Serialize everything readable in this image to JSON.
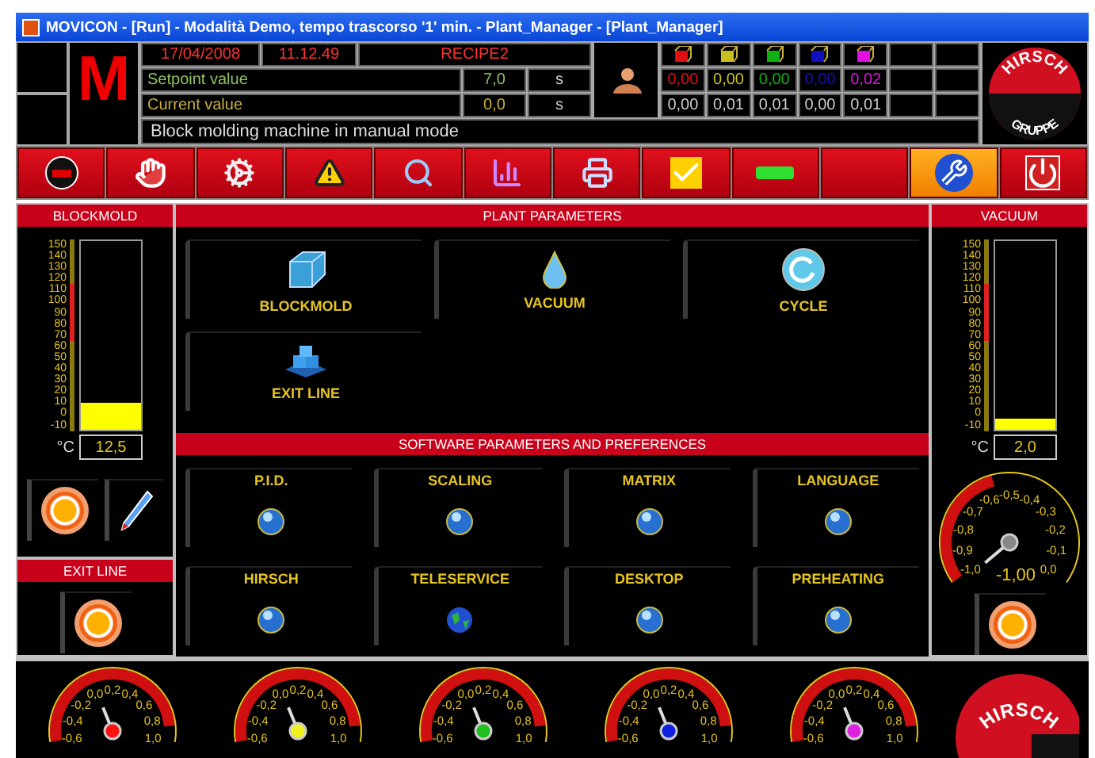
{
  "window": {
    "title": "MOVICON - [Run] - Modalità Demo, tempo trascorso '1' min. - Plant_Manager - [Plant_Manager]"
  },
  "header": {
    "logo_letter": "M",
    "date": "17/04/2008",
    "time": "11.12.49",
    "recipe": "RECIPE2",
    "setpoint": {
      "label": "Setpoint value",
      "value": "7,0",
      "unit": "s"
    },
    "current": {
      "label": "Current value",
      "value": "0,0",
      "unit": "s"
    },
    "channels": [
      {
        "color": "#e01010",
        "setpoint": "0,00",
        "current": "0,00"
      },
      {
        "color": "#c8c020",
        "setpoint": "0,00",
        "current": "0,01"
      },
      {
        "color": "#10b010",
        "setpoint": "0,00",
        "current": "0,01"
      },
      {
        "color": "#1010c0",
        "setpoint": "0,00",
        "current": "0,00"
      },
      {
        "color": "#e010e0",
        "setpoint": "0,02",
        "current": "0,01"
      }
    ],
    "message": "Block molding machine in manual mode",
    "brand": {
      "top": "HIRSCH",
      "bottom": "GRUPPE"
    }
  },
  "toolbar": [
    {
      "kind": "logo",
      "selected": false
    },
    {
      "kind": "hand",
      "selected": false
    },
    {
      "kind": "gear",
      "selected": false
    },
    {
      "kind": "warning",
      "selected": false
    },
    {
      "kind": "search",
      "selected": false
    },
    {
      "kind": "chart",
      "selected": false
    },
    {
      "kind": "printer",
      "selected": false
    },
    {
      "kind": "check",
      "selected": false
    },
    {
      "kind": "minus",
      "selected": false
    },
    {
      "kind": "blank",
      "selected": false
    },
    {
      "kind": "tools",
      "selected": true
    },
    {
      "kind": "power",
      "selected": false
    }
  ],
  "blockmold": {
    "title": "BLOCKMOLD",
    "scale": [
      "150",
      "140",
      "130",
      "120",
      "110",
      "100",
      "90",
      "80",
      "70",
      "60",
      "50",
      "40",
      "30",
      "20",
      "10",
      "0",
      "-10"
    ],
    "unit": "°C",
    "value": "12,5",
    "level": 0.14
  },
  "exit_line": {
    "title": "EXIT LINE"
  },
  "plant_parameters": {
    "title": "PLANT PARAMETERS",
    "items": [
      {
        "label": "BLOCKMOLD",
        "kind": "cube"
      },
      {
        "label": "VACUUM",
        "kind": "drop"
      },
      {
        "label": "CYCLE",
        "kind": "cycle"
      },
      {
        "label": "EXIT LINE",
        "kind": "blocks"
      }
    ]
  },
  "software_parameters": {
    "title": "SOFTWARE PARAMETERS AND PREFERENCES",
    "items": [
      {
        "label": "P.I.D.",
        "kind": "sphere"
      },
      {
        "label": "SCALING",
        "kind": "sphere"
      },
      {
        "label": "MATRIX",
        "kind": "sphere"
      },
      {
        "label": "LANGUAGE",
        "kind": "sphere"
      },
      {
        "label": "HIRSCH",
        "kind": "sphere"
      },
      {
        "label": "TELESERVICE",
        "kind": "globe"
      },
      {
        "label": "DESKTOP",
        "kind": "sphere"
      },
      {
        "label": "PREHEATING",
        "kind": "sphere"
      }
    ]
  },
  "vacuum": {
    "title": "VACUUM",
    "scale": [
      "150",
      "140",
      "130",
      "120",
      "110",
      "100",
      "90",
      "80",
      "70",
      "60",
      "50",
      "40",
      "30",
      "20",
      "10",
      "0",
      "-10"
    ],
    "unit": "°C",
    "value": "2,0",
    "level": 0.06,
    "gauge": {
      "labels": [
        "-1,0",
        "-0,9",
        "-0,8",
        "-0,7",
        "-0,6",
        "-0,5",
        "-0,4",
        "-0,3",
        "-0,2",
        "-0,1",
        "0,0"
      ],
      "value": "-1,00"
    }
  },
  "gauges": [
    {
      "color": "#ff1010",
      "labels": [
        "-0,6",
        "-0,4",
        "-0,2",
        "0,0",
        "0,2",
        "0,4",
        "0,6",
        "0,8",
        "1,0"
      ]
    },
    {
      "color": "#f0f020",
      "labels": [
        "-0,6",
        "-0,4",
        "-0,2",
        "0,0",
        "0,2",
        "0,4",
        "0,6",
        "0,8",
        "1,0"
      ]
    },
    {
      "color": "#20c020",
      "labels": [
        "-0,6",
        "-0,4",
        "-0,2",
        "0,0",
        "0,2",
        "0,4",
        "0,6",
        "0,8",
        "1,0"
      ]
    },
    {
      "color": "#1020e0",
      "labels": [
        "-0,6",
        "-0,4",
        "-0,2",
        "0,0",
        "0,2",
        "0,4",
        "0,6",
        "0,8",
        "1,0"
      ]
    },
    {
      "color": "#e020e0",
      "labels": [
        "-0,6",
        "-0,4",
        "-0,2",
        "0,0",
        "0,2",
        "0,4",
        "0,6",
        "0,8",
        "1,0"
      ]
    }
  ],
  "footer_brand": {
    "text": "HIRSCH"
  }
}
